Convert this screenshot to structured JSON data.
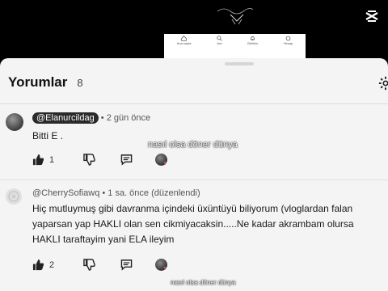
{
  "preview": {
    "nav": [
      {
        "label": "Ana sayfa",
        "icon": "home-icon"
      },
      {
        "label": "Ara",
        "icon": "search-icon"
      },
      {
        "label": "Bildirim",
        "icon": "bell-icon"
      },
      {
        "label": "Hesap",
        "icon": "profile-icon"
      }
    ]
  },
  "comments_panel": {
    "title": "Yorumlar",
    "count": "8"
  },
  "comments": [
    {
      "author": "@Elanurcildag",
      "time": "• 2 gün önce",
      "text_lines": [
        "Bitti E ."
      ],
      "likes": "1"
    },
    {
      "author": "@CherrySofiawq",
      "time": "• 1 sa. önce (düzenlendi)",
      "text_lines": [
        "Hiç mutluymuş gibi davranma içindeki üxüntüyü biliyorum (vloglardan falan",
        "yaparsan yap HAKLI olan sen cikmiyacaksin.....Ne kadar akrambam olursa",
        "HAKLI taraftayim yani ELA ileyim"
      ],
      "likes": "2"
    }
  ],
  "overlays": {
    "caption": "nasıl olsa döner dünya",
    "watermark": "nasıl olsa döner dünya"
  },
  "colors": {
    "sheet_bg": "#f4f4f4",
    "top_bg": "#000000",
    "heart": "#c0506a"
  }
}
